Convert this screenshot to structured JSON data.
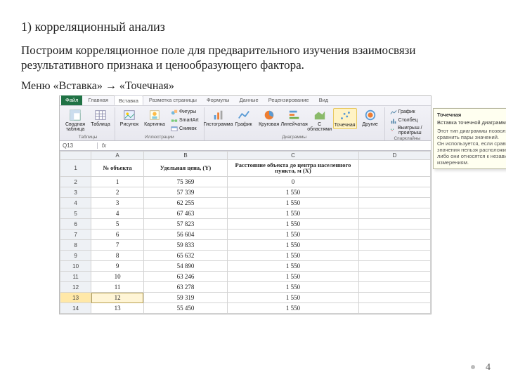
{
  "slide": {
    "title": "1) корреляционный анализ",
    "paragraph": "Построим корреляционное поле для предварительного изучения взаимосвязи результативного признака и ценообразующего фактора.",
    "menuLine": "Меню «Вставка» → «Точечная»",
    "pageNumber": "4"
  },
  "excel": {
    "tabs": {
      "file": "Файл",
      "items": [
        "Главная",
        "Вставка",
        "Разметка страницы",
        "Формулы",
        "Данные",
        "Рецензирование",
        "Вид"
      ],
      "activeIndex": 1
    },
    "ribbon": {
      "group_tables": {
        "label": "Таблицы",
        "pivot": "Сводная таблица",
        "table": "Таблица"
      },
      "group_illustr": {
        "label": "Иллюстрации",
        "picture": "Рисунок",
        "clipart": "Картинка",
        "shapes": "Фигуры",
        "smartart": "SmartArt",
        "screenshot": "Снимок"
      },
      "group_charts": {
        "label": "Диаграммы",
        "column": "Гистограмма",
        "line": "График",
        "pie": "Круговая",
        "bar": "Линейчатая",
        "area": "С областями",
        "scatter": "Точечная",
        "other": "Другие"
      },
      "group_spark": {
        "label": "Спарклайны",
        "l1": "График",
        "l2": "Столбец",
        "l3": "Выигрыш / проигрыш"
      }
    },
    "formulaBar": {
      "nameBox": "Q13",
      "fx": "fx",
      "value": ""
    },
    "columns": [
      "",
      "A",
      "B",
      "C",
      "D"
    ],
    "headers": {
      "a": "№ объекта",
      "b": "Удельная цена, (Y)",
      "c": "Расстояние объекта до центра населенного пункта, м (X)"
    },
    "rows": [
      {
        "n": 1,
        "y": "75 369",
        "x": "0"
      },
      {
        "n": 2,
        "y": "57 339",
        "x": "1 550"
      },
      {
        "n": 3,
        "y": "62 255",
        "x": "1 550"
      },
      {
        "n": 4,
        "y": "67 463",
        "x": "1 550"
      },
      {
        "n": 5,
        "y": "57 823",
        "x": "1 550"
      },
      {
        "n": 6,
        "y": "56 604",
        "x": "1 550"
      },
      {
        "n": 7,
        "y": "59 833",
        "x": "1 550"
      },
      {
        "n": 8,
        "y": "65 632",
        "x": "1 550"
      },
      {
        "n": 9,
        "y": "54 890",
        "x": "1 550"
      },
      {
        "n": 10,
        "y": "63 246",
        "x": "1 550"
      },
      {
        "n": 11,
        "y": "63 278",
        "x": "1 550"
      },
      {
        "n": 12,
        "y": "59 319",
        "x": "1 550"
      },
      {
        "n": 13,
        "y": "55 450",
        "x": "1 550"
      }
    ],
    "selectedDataRow": 12
  },
  "tooltip": {
    "title": "Точечная",
    "sub": "Вставка точечной диаграммы.",
    "body": "Этот тип диаграммы позволяет сравнить пары значений.\\nОн используется, если сравниваемые значения нельзя расположить на оси X либо они относятся к независимым измерениям."
  }
}
